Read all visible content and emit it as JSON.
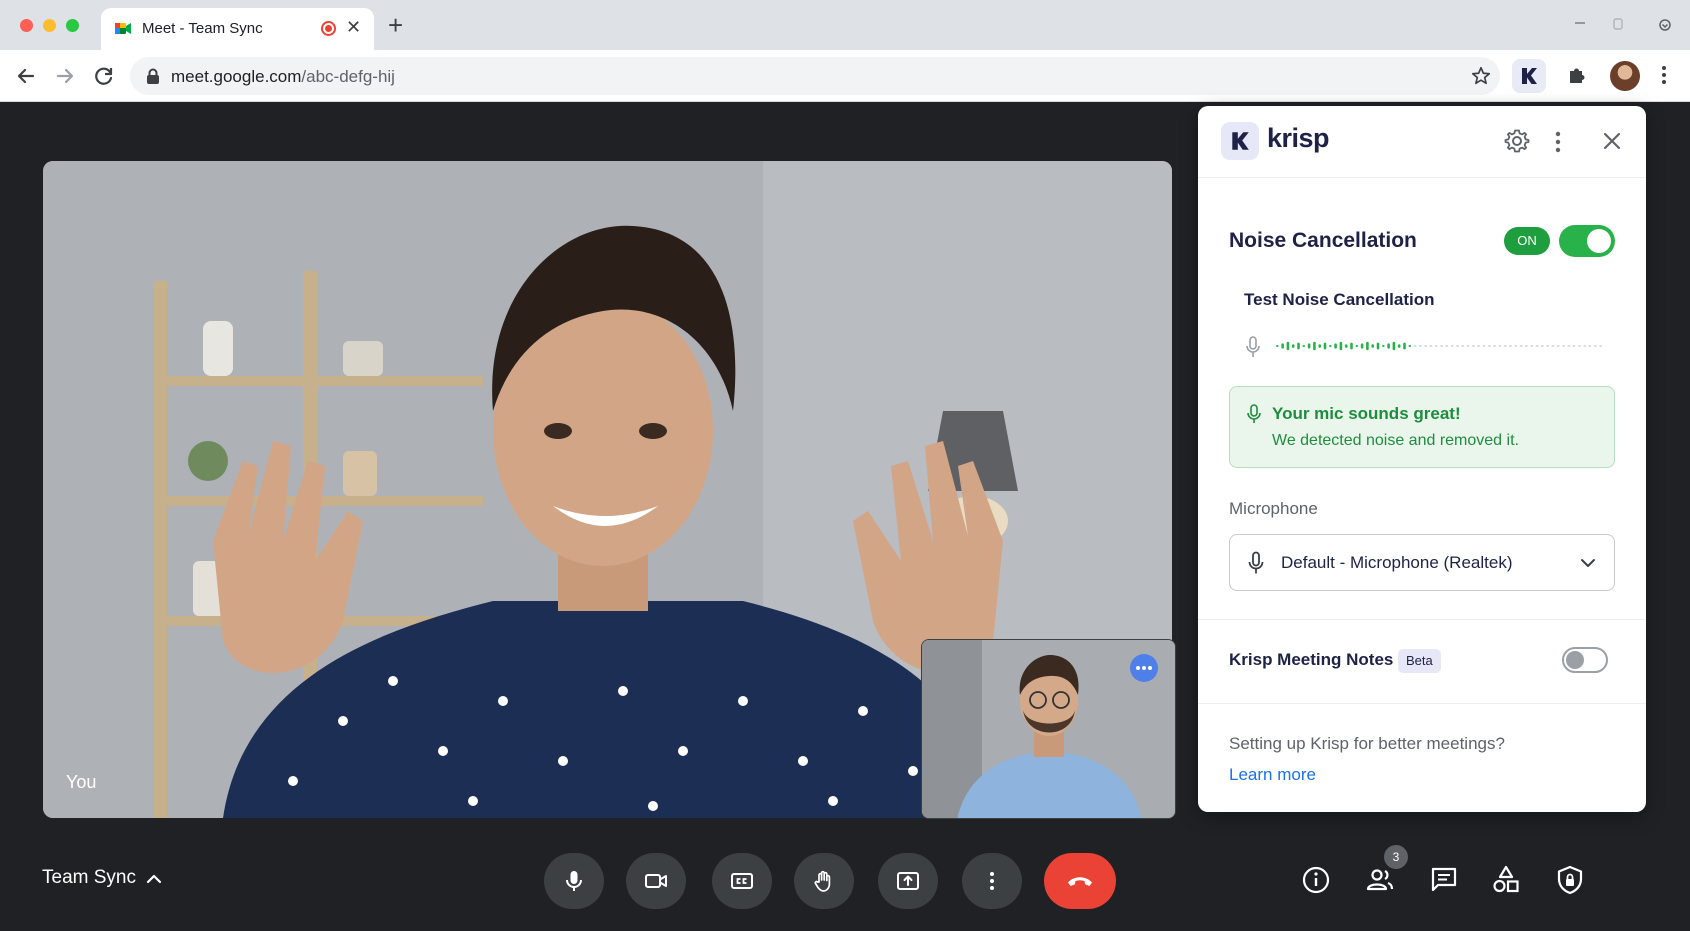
{
  "browser": {
    "tab_title": "Meet - Team Sync",
    "new_tab": "+",
    "close_tab": "✕",
    "url_host": "meet.google.com",
    "url_path": "/abc-defg-hij"
  },
  "meet": {
    "self_label": "You",
    "meeting_name": "Team Sync",
    "participants_count": "3"
  },
  "krisp": {
    "brand": "krisp",
    "noise_cancellation": {
      "title": "Noise Cancellation",
      "status": "ON",
      "enabled": true
    },
    "test": {
      "title": "Test Noise Cancellation"
    },
    "notice": {
      "title": "Your mic sounds great!",
      "subtitle": "We detected noise and removed it."
    },
    "microphone": {
      "label": "Microphone",
      "selected": "Default - Microphone (Realtek)"
    },
    "meeting_notes": {
      "title": "Krisp Meeting Notes",
      "badge": "Beta",
      "enabled": false
    },
    "footer": {
      "text": "Setting up Krisp for better meetings?",
      "link": "Learn more"
    }
  },
  "colors": {
    "accent_green": "#1e9e3e",
    "end_call_red": "#ea4335",
    "link_blue": "#1a73e8",
    "krisp_navy": "#1f2247"
  }
}
